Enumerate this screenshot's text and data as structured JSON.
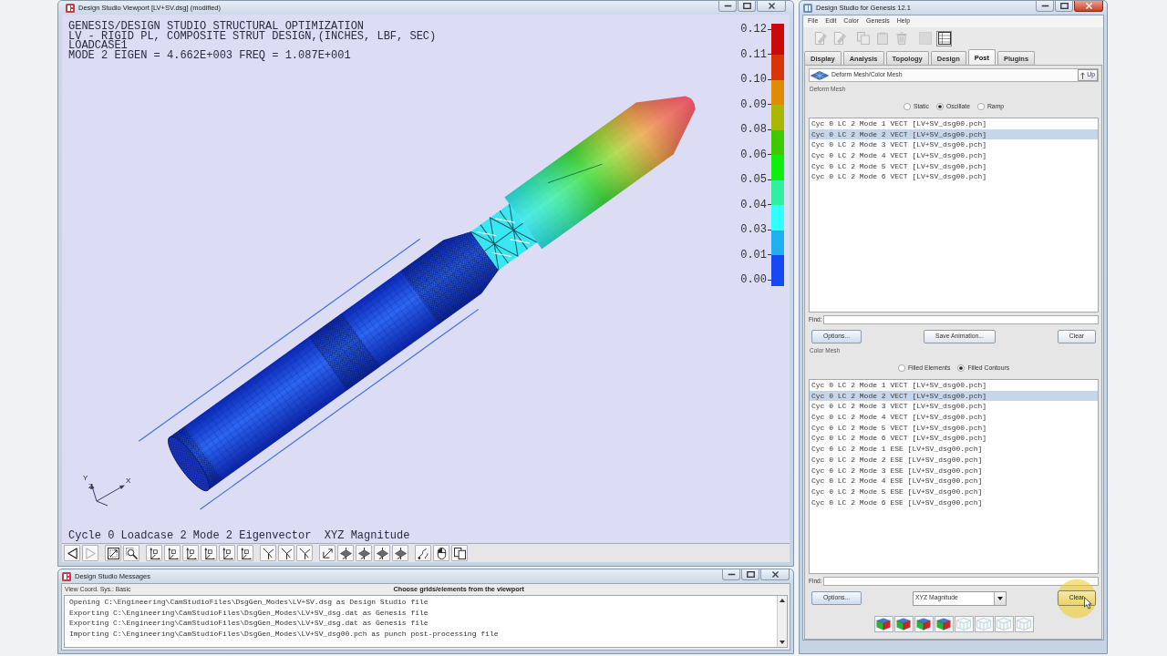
{
  "viewport": {
    "title": "Design Studio Viewport [LV+SV.dsg] (modified)",
    "active": false,
    "header_lines": [
      "GENESIS/DESIGN STUDIO STRUCTURAL OPTIMIZATION",
      "LV - RIGID PL, COMPOSITE STRUT DESIGN,(INCHES, LBF, SEC)",
      "LOADCASE1",
      "MODE 2 EIGEN = 4.662E+003 FREQ = 1.087E+001"
    ],
    "legend": {
      "ticks": [
        "0.12",
        "0.11",
        "0.10",
        "0.09",
        "0.08",
        "0.06",
        "0.05",
        "0.04",
        "0.03",
        "0.01",
        "0.00"
      ],
      "bands": [
        {
          "color": "#c80a0a"
        },
        {
          "color": "#d8340a"
        },
        {
          "color": "#e08c00"
        },
        {
          "color": "#a8b800"
        },
        {
          "color": "#40c800"
        },
        {
          "color": "#10ee10"
        },
        {
          "color": "#30f0a0"
        },
        {
          "color": "#30ffff"
        },
        {
          "color": "#20b0f0"
        },
        {
          "color": "#1848f0"
        }
      ]
    },
    "triad": {
      "labels": [
        "Y",
        "Z",
        "X"
      ]
    },
    "status": "Cycle 0 Loadcase 2 Mode 2 Eigenvector  XYZ Magnitude",
    "toolbar": [
      {
        "items": [
          {
            "kind": "back",
            "disabled": false
          },
          {
            "kind": "forward",
            "disabled": true
          }
        ]
      },
      {
        "items": [
          {
            "kind": "zoom-fit",
            "disabled": false
          },
          {
            "kind": "zoom-window",
            "disabled": false
          }
        ]
      },
      {
        "items": [
          {
            "kind": "view-axes",
            "disabled": false
          },
          {
            "kind": "view-axes",
            "disabled": false
          },
          {
            "kind": "view-axes",
            "disabled": false
          },
          {
            "kind": "view-axes",
            "disabled": false
          },
          {
            "kind": "view-axes",
            "disabled": false
          },
          {
            "kind": "view-axes",
            "disabled": false
          }
        ]
      },
      {
        "items": [
          {
            "kind": "branch",
            "disabled": false
          },
          {
            "kind": "branch",
            "disabled": false
          },
          {
            "kind": "branch",
            "disabled": false
          }
        ]
      },
      {
        "items": [
          {
            "kind": "arrow-axes",
            "disabled": false
          },
          {
            "kind": "plate",
            "disabled": false
          },
          {
            "kind": "plate",
            "disabled": false
          },
          {
            "kind": "plate",
            "disabled": false
          },
          {
            "kind": "plate",
            "disabled": false
          }
        ]
      },
      {
        "items": [
          {
            "kind": "curve",
            "disabled": false
          },
          {
            "kind": "mouse",
            "disabled": false
          },
          {
            "kind": "pages",
            "disabled": false
          }
        ]
      }
    ]
  },
  "messages": {
    "title": "Design Studio Messages",
    "active": false,
    "coord_sys": "View Coord. Sys.: Basic",
    "prompt": "Choose grids/elements from the viewport",
    "lines": [
      "Opening C:\\Engineering\\CamStudioFiles\\DsgGen_Modes\\LV+SV.dsg as Design Studio file",
      "Exporting C:\\Engineering\\CamStudioFiles\\DsgGen_Modes\\LV+SV_dsg.dat as Genesis file",
      "Exporting C:\\Engineering\\CamStudioFiles\\DsgGen_Modes\\LV+SV_dsg.dat as Genesis file",
      "Importing C:\\Engineering\\CamStudioFiles\\DsgGen_Modes\\LV+SV_dsg00.pch as punch post-processing file"
    ]
  },
  "main": {
    "title": "Design Studio for Genesis 12.1",
    "active": true,
    "menu": [
      "File",
      "Edit",
      "Color",
      "Genesis",
      "Help"
    ],
    "toolbar": [
      {
        "items": [
          {
            "kind": "page-edit",
            "disabled": true
          },
          {
            "kind": "page-edit",
            "disabled": true
          }
        ]
      },
      {
        "items": [
          {
            "kind": "copy",
            "disabled": true
          },
          {
            "kind": "clipboard",
            "disabled": true
          },
          {
            "kind": "trash",
            "disabled": true
          }
        ]
      },
      {
        "items": [
          {
            "kind": "blank",
            "disabled": true
          },
          {
            "kind": "grid",
            "disabled": false
          }
        ]
      }
    ],
    "tabs": [
      {
        "label": "Display",
        "selected": false
      },
      {
        "label": "Analysis",
        "selected": false
      },
      {
        "label": "Topology",
        "selected": false
      },
      {
        "label": "Design",
        "selected": false
      },
      {
        "label": "Post",
        "selected": true
      },
      {
        "label": "Plugins",
        "selected": false
      }
    ],
    "breadcrumb": "Deform Mesh/Color Mesh",
    "up_button": "Up",
    "deform": {
      "label": "Deform Mesh",
      "modes": [
        {
          "label": "Static",
          "selected": false
        },
        {
          "label": "Oscillate",
          "selected": true
        },
        {
          "label": "Ramp",
          "selected": false
        }
      ],
      "items": [
        {
          "text": "Cyc 0 LC 2 Mode 1 VECT [LV+SV_dsg00.pch]",
          "selected": false
        },
        {
          "text": "Cyc 0 LC 2 Mode 2 VECT [LV+SV_dsg00.pch]",
          "selected": true
        },
        {
          "text": "Cyc 0 LC 2 Mode 3 VECT [LV+SV_dsg00.pch]",
          "selected": false
        },
        {
          "text": "Cyc 0 LC 2 Mode 4 VECT [LV+SV_dsg00.pch]",
          "selected": false
        },
        {
          "text": "Cyc 0 LC 2 Mode 5 VECT [LV+SV_dsg00.pch]",
          "selected": false
        },
        {
          "text": "Cyc 0 LC 2 Mode 6 VECT [LV+SV_dsg00.pch]",
          "selected": false
        }
      ],
      "find_label": "Find:",
      "buttons": [
        "Options...",
        "Save Animation...",
        "Clear"
      ]
    },
    "color": {
      "label": "Color Mesh",
      "modes": [
        {
          "label": "Filled Elements",
          "selected": false
        },
        {
          "label": "Filled Contours",
          "selected": true
        }
      ],
      "items": [
        {
          "text": "Cyc 0 LC 2 Mode 1 VECT [LV+SV_dsg00.pch]",
          "selected": false
        },
        {
          "text": "Cyc 0 LC 2 Mode 2 VECT [LV+SV_dsg00.pch]",
          "selected": true
        },
        {
          "text": "Cyc 0 LC 2 Mode 3 VECT [LV+SV_dsg00.pch]",
          "selected": false
        },
        {
          "text": "Cyc 0 LC 2 Mode 4 VECT [LV+SV_dsg00.pch]",
          "selected": false
        },
        {
          "text": "Cyc 0 LC 2 Mode 5 VECT [LV+SV_dsg00.pch]",
          "selected": false
        },
        {
          "text": "Cyc 0 LC 2 Mode 6 VECT [LV+SV_dsg00.pch]",
          "selected": false
        },
        {
          "text": "Cyc 0 LC 2 Mode 1 ESE [LV+SV_dsg00.pch]",
          "selected": false
        },
        {
          "text": "Cyc 0 LC 2 Mode 2 ESE [LV+SV_dsg00.pch]",
          "selected": false
        },
        {
          "text": "Cyc 0 LC 2 Mode 3 ESE [LV+SV_dsg00.pch]",
          "selected": false
        },
        {
          "text": "Cyc 0 LC 2 Mode 4 ESE [LV+SV_dsg00.pch]",
          "selected": false
        },
        {
          "text": "Cyc 0 LC 2 Mode 5 ESE [LV+SV_dsg00.pch]",
          "selected": false
        },
        {
          "text": "Cyc 0 LC 2 Mode 6 ESE [LV+SV_dsg00.pch]",
          "selected": false
        }
      ],
      "find_label": "Find:",
      "options_button": "Options...",
      "dropdown": "XYZ Magnitude",
      "clear_button": "Clear"
    },
    "display_icons": [
      {
        "kind": "shaded",
        "disabled": false
      },
      {
        "kind": "shaded",
        "disabled": false
      },
      {
        "kind": "shaded",
        "disabled": false
      },
      {
        "kind": "shaded",
        "disabled": false
      },
      {
        "kind": "wire",
        "disabled": true
      },
      {
        "kind": "wire",
        "disabled": true
      },
      {
        "kind": "wire",
        "disabled": true
      },
      {
        "kind": "wire",
        "disabled": true
      }
    ]
  }
}
